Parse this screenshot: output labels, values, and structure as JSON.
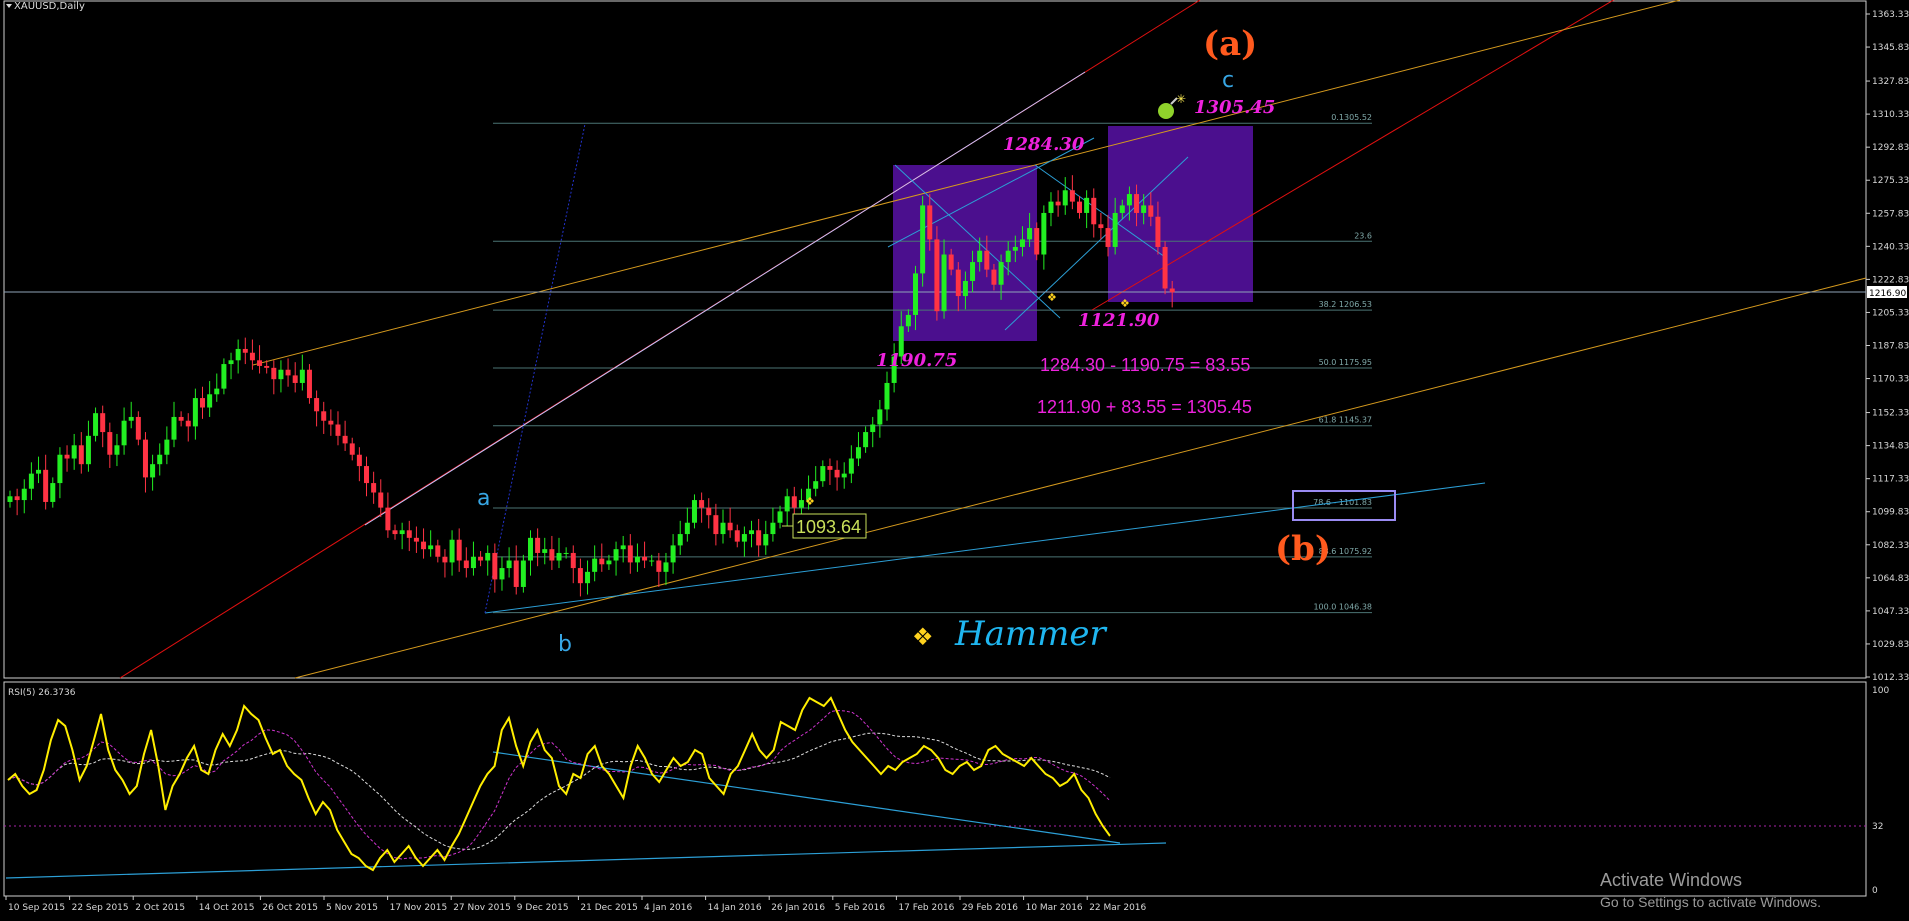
{
  "chart_data": {
    "type": "candlestick",
    "symbol": "XAUUSD,Daily",
    "price_axis_ticks": [
      "1363.33",
      "1345.83",
      "1327.83",
      "1310.33",
      "1292.83",
      "1275.33",
      "1257.83",
      "1240.33",
      "1222.83",
      "1205.33",
      "1187.83",
      "1170.33",
      "1152.33",
      "1134.83",
      "1117.33",
      "1099.83",
      "1082.33",
      "1064.83",
      "1047.33",
      "1029.83",
      "1012.33"
    ],
    "current_price": "1216.90",
    "date_ticks": [
      "10 Sep 2015",
      "22 Sep 2015",
      "2 Oct 2015",
      "14 Oct 2015",
      "26 Oct 2015",
      "5 Nov 2015",
      "17 Nov 2015",
      "27 Nov 2015",
      "9 Dec 2015",
      "21 Dec 2015",
      "4 Jan 2016",
      "14 Jan 2016",
      "26 Jan 2016",
      "5 Feb 2016",
      "17 Feb 2016",
      "29 Feb 2016",
      "10 Mar 2016",
      "22 Mar 2016"
    ],
    "closes": [
      1108,
      1106,
      1112,
      1120,
      1122,
      1105,
      1115,
      1130,
      1128,
      1135,
      1125,
      1140,
      1152,
      1142,
      1130,
      1135,
      1148,
      1150,
      1138,
      1118,
      1125,
      1130,
      1138,
      1150,
      1148,
      1145,
      1160,
      1155,
      1162,
      1165,
      1178,
      1180,
      1186,
      1184,
      1180,
      1177,
      1176,
      1170,
      1175,
      1172,
      1168,
      1175,
      1160,
      1153,
      1148,
      1146,
      1140,
      1136,
      1130,
      1124,
      1115,
      1110,
      1102,
      1090,
      1088,
      1090,
      1086,
      1084,
      1080,
      1082,
      1076,
      1073,
      1085,
      1074,
      1070,
      1076,
      1074,
      1078,
      1064,
      1070,
      1074,
      1060,
      1074,
      1086,
      1078,
      1080,
      1074,
      1078,
      1078,
      1070,
      1062,
      1068,
      1075,
      1072,
      1074,
      1080,
      1082,
      1073,
      1076,
      1074,
      1074,
      1068,
      1073,
      1082,
      1088,
      1094,
      1106,
      1102,
      1098,
      1088,
      1094,
      1090,
      1084,
      1088,
      1090,
      1082,
      1088,
      1094,
      1100,
      1108,
      1102,
      1106,
      1112,
      1116,
      1124,
      1122,
      1118,
      1120,
      1128,
      1134,
      1142,
      1146,
      1154,
      1168,
      1182,
      1198,
      1204,
      1226,
      1262,
      1244,
      1206,
      1236,
      1228,
      1214,
      1222,
      1232,
      1238,
      1228,
      1220,
      1232,
      1238,
      1240,
      1244,
      1250,
      1236,
      1258,
      1264,
      1262,
      1270,
      1264,
      1258,
      1266,
      1252,
      1250,
      1240,
      1258,
      1262,
      1268,
      1258,
      1262,
      1256,
      1240,
      1218,
      1216
    ],
    "rsi": {
      "label": "RSI(5) 26.3736",
      "axis_ticks": [
        "100",
        "32",
        "0"
      ],
      "level": 32,
      "values": [
        55,
        58,
        52,
        48,
        50,
        60,
        75,
        85,
        82,
        70,
        55,
        62,
        75,
        88,
        70,
        60,
        55,
        48,
        52,
        68,
        80,
        62,
        40,
        52,
        58,
        66,
        72,
        60,
        58,
        70,
        78,
        72,
        80,
        92,
        88,
        85,
        76,
        68,
        70,
        62,
        58,
        55,
        46,
        38,
        44,
        40,
        30,
        24,
        18,
        16,
        12,
        10,
        16,
        20,
        14,
        18,
        22,
        16,
        12,
        16,
        20,
        15,
        22,
        28,
        36,
        44,
        52,
        58,
        62,
        80,
        86,
        72,
        62,
        74,
        80,
        70,
        66,
        52,
        48,
        58,
        56,
        68,
        72,
        62,
        58,
        52,
        46,
        62,
        72,
        66,
        58,
        54,
        60,
        66,
        62,
        64,
        70,
        68,
        56,
        52,
        48,
        58,
        62,
        70,
        78,
        70,
        66,
        70,
        84,
        82,
        80,
        90,
        96,
        94,
        92,
        96,
        88,
        80,
        74,
        70,
        66,
        62,
        58,
        62,
        60,
        64,
        66,
        68,
        72,
        70,
        66,
        60,
        58,
        62,
        64,
        60,
        62,
        70,
        72,
        68,
        66,
        64,
        62,
        66,
        62,
        58,
        56,
        52,
        54,
        58,
        50,
        46,
        38,
        32,
        27
      ]
    },
    "fib_levels": [
      {
        "label": "0.1305.52",
        "value": 1305.52
      },
      {
        "label": "23.6",
        "value": 1243
      },
      {
        "label": "38.2 1206.53",
        "value": 1206.53
      },
      {
        "label": "50.0 1175.95",
        "value": 1175.95
      },
      {
        "label": "61.8 1145.37",
        "value": 1145.37
      },
      {
        "label": "78.6 - 1101.83",
        "value": 1101.83
      },
      {
        "label": "88.6 1075.92",
        "value": 1075.92
      },
      {
        "label": "100.0 1046.38",
        "value": 1046.38
      }
    ],
    "annotations": {
      "wave_a_top": "(a)",
      "wave_c_top": "c",
      "wave_a_low": "a",
      "wave_b_low": "b",
      "wave_b_mid": "(b)",
      "target": "1305.45",
      "high": "1284.30",
      "low1": "1190.75",
      "low2": "1121.90",
      "calc1": "1284.30 - 1190.75 = 83.55",
      "calc2": "1211.90 + 83.55 = 1305.45",
      "box_price": "1093.64",
      "legend_text": "Hammer"
    }
  },
  "watermark": {
    "line1": "Activate Windows",
    "line2": "Go to Settings to activate Windows."
  },
  "colors": {
    "bull": "#22ee22",
    "bear": "#ff3344",
    "magenta": "#ee22dd",
    "fib": "#6f9e9e",
    "rsi": "#ffee00"
  }
}
